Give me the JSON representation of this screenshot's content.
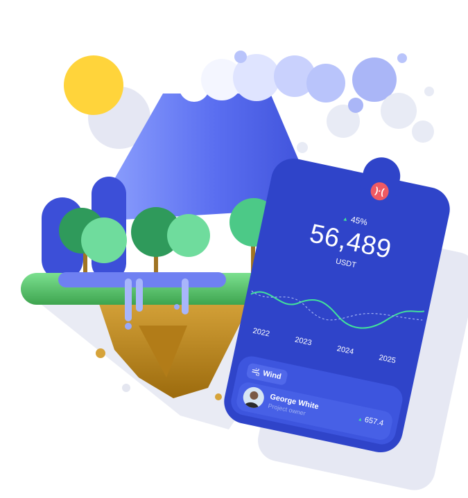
{
  "card": {
    "logo_glyph": ")·(",
    "change_percent": "45%",
    "value": "56,489",
    "unit": "USDT",
    "years": [
      "2022",
      "2023",
      "2024",
      "2025"
    ],
    "tag_label": "Wind",
    "user_name": "George White",
    "user_role": "Project owner",
    "stat_value": "657.4"
  },
  "colors": {
    "card": "#2f44c9",
    "accent_green": "#42e39a",
    "logo": "#ef5a63",
    "mountain": "#5a6ef0",
    "sun": "#ffd43b",
    "trees": "#4fd08c"
  },
  "icons": [
    "sun-icon",
    "wind-icon",
    "trend-up-icon",
    "brand-logo"
  ]
}
